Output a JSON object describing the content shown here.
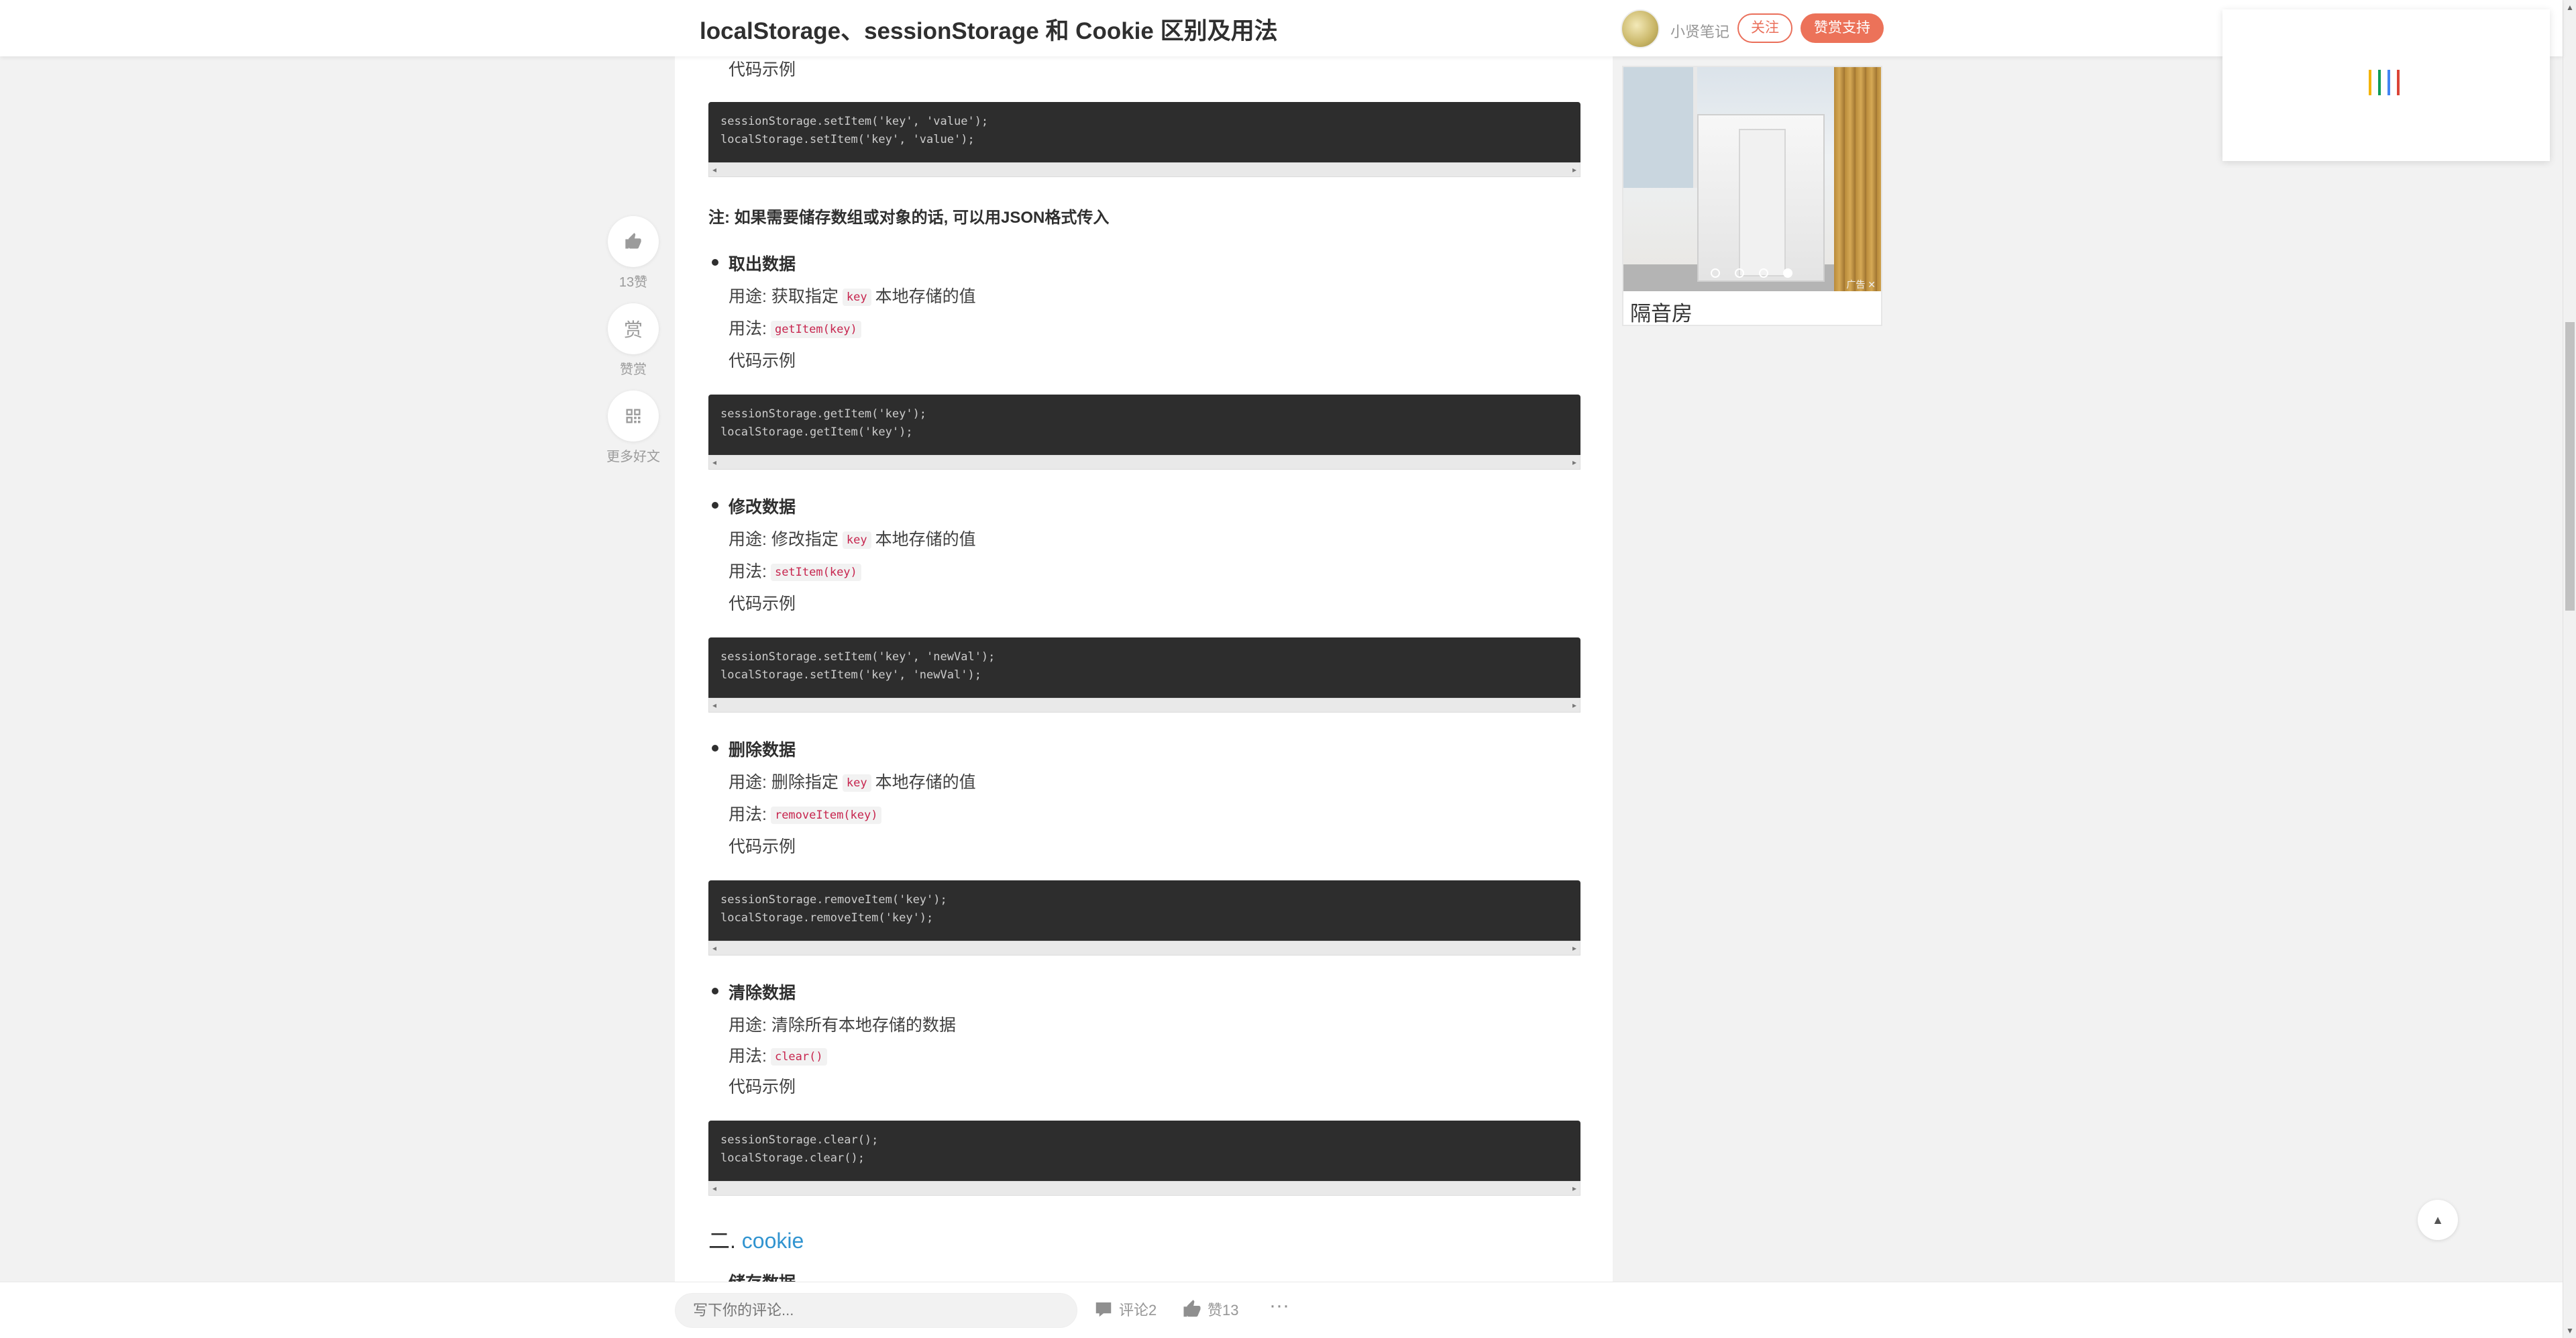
{
  "header": {
    "title": "localStorage、sessionStorage 和 Cookie 区别及用法",
    "author_name": "小贤笔记",
    "follow_label": "关注",
    "support_label": "赞赏支持"
  },
  "side_actions": {
    "like_count_label": "13赞",
    "reward_glyph": "赏",
    "reward_label": "赞赏",
    "more_label": "更多好文"
  },
  "article": {
    "code_example_label": "代码示例",
    "code_save": "sessionStorage.setItem('key', 'value');\nlocalStorage.setItem('key', 'value');",
    "note": "注: 如果需要储存数组或对象的话, 可以用JSON格式传入",
    "sections": [
      {
        "title": "取出数据",
        "usage_prefix": "用途: 获取指定",
        "usage_key": "key",
        "usage_suffix": "本地存储的值",
        "method_prefix": "用法:",
        "method": "getItem(key)",
        "example_label": "代码示例",
        "code": "sessionStorage.getItem('key');\nlocalStorage.getItem('key');"
      },
      {
        "title": "修改数据",
        "usage_prefix": "用途: 修改指定",
        "usage_key": "key",
        "usage_suffix": "本地存储的值",
        "method_prefix": "用法:",
        "method": "setItem(key)",
        "example_label": "代码示例",
        "code": "sessionStorage.setItem('key', 'newVal');\nlocalStorage.setItem('key', 'newVal');"
      },
      {
        "title": "删除数据",
        "usage_prefix": "用途: 删除指定",
        "usage_key": "key",
        "usage_suffix": "本地存储的值",
        "method_prefix": "用法:",
        "method": "removeItem(key)",
        "example_label": "代码示例",
        "code": "sessionStorage.removeItem('key');\nlocalStorage.removeItem('key');"
      },
      {
        "title": "清除数据",
        "usage_text": "用途: 清除所有本地存储的数据",
        "method_prefix": "用法:",
        "method": "clear()",
        "example_label": "代码示例",
        "code": "sessionStorage.clear();\nlocalStorage.clear();"
      }
    ],
    "heading2_prefix": "二.",
    "heading2_link": "cookie",
    "cut_off_text": "储存数据"
  },
  "sidebar_ad": {
    "caption": "隔音房",
    "ad_mark": "广告 ✕",
    "carousel_active_index": 3,
    "carousel_count": 4
  },
  "popup_loader_colors": [
    "#f4b400",
    "#0f9d58",
    "#4285f4",
    "#db4437"
  ],
  "bottom_bar": {
    "comment_placeholder": "写下你的评论...",
    "comment_label": "评论2",
    "like_label": "赞13",
    "more_label": "···"
  },
  "colors": {
    "accent": "#ea6f5a",
    "link": "#3194d0",
    "code_bg": "#2d2d2d",
    "inline_code": "#c7254e"
  }
}
